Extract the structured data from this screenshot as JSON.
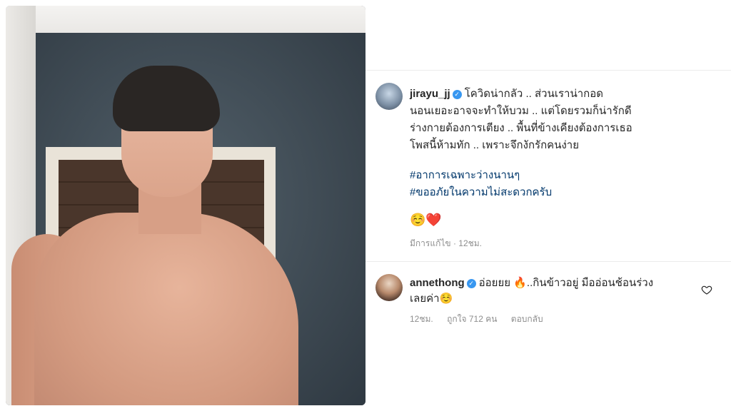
{
  "post": {
    "username": "jirayu_jj",
    "caption_lines": [
      "โควิดน่ากลัว .. ส่วนเราน่ากอด",
      "นอนเยอะอาจจะทำให้บวม .. แต่โดยรวมก็น่ารักดี",
      "ร่างกายต้องการเตียง .. พื้นที่ข้างเคียงต้องการเธอ",
      "โพสนี้ห้ามทัก .. เพราะจึกงักรักคนง่าย"
    ],
    "hashtags": [
      "#อาการเฉพาะว่างนานๆ",
      "#ขออภัยในความไม่สะดวกครับ"
    ],
    "emojis": [
      "☺️",
      "❤️"
    ],
    "edited_label": "มีการแก้ไข",
    "time": "12ชม."
  },
  "comment": {
    "username": "annethong",
    "text_line1_a": "อ่อยยย",
    "flame": "🔥",
    "text_line1_b": "..กินข้าวอยู่ มืออ่อนช้อนร่วง",
    "text_line2": "เลยค่า☺️",
    "time": "12ชม.",
    "likes": "ถูกใจ 712 คน",
    "reply": "ตอบกลับ"
  },
  "icons": {
    "verified": "verified-badge-icon",
    "like": "heart-outline-icon"
  },
  "colors": {
    "verified": "#3897f0",
    "hashtag": "#00376b",
    "meta": "#8e8e8e"
  }
}
